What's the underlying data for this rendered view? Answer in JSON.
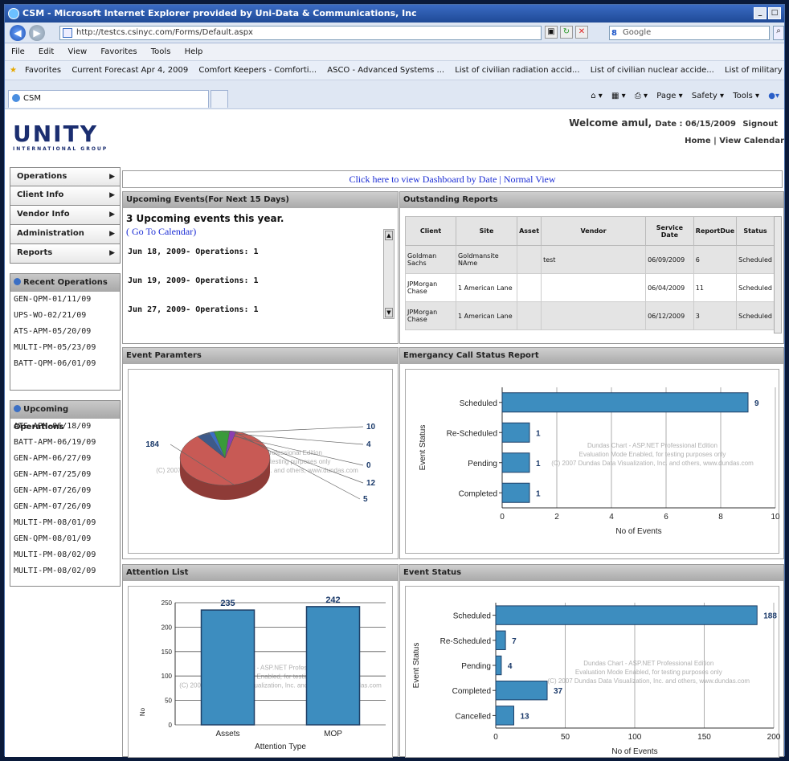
{
  "window": {
    "title": "CSM - Microsoft Internet Explorer provided by Uni-Data & Communications, Inc"
  },
  "address": {
    "url": "http://testcs.csinyc.com/Forms/Default.aspx",
    "search_placeholder": "Google"
  },
  "menu": [
    "File",
    "Edit",
    "View",
    "Favorites",
    "Tools",
    "Help"
  ],
  "favorites": {
    "label": "Favorites",
    "items": [
      "Current Forecast Apr 4, 2009",
      "Comfort Keepers - Comforti...",
      "ASCO - Advanced Systems ...",
      "List of civilian radiation accid...",
      "List of civilian nuclear accide...",
      "List of military nuclear accid..."
    ]
  },
  "tab": {
    "label": "CSM"
  },
  "commandbar": [
    "Page ▾",
    "Safety ▾",
    "Tools ▾"
  ],
  "header": {
    "logo_main": "UNITY",
    "logo_sub": "INTERNATIONAL GROUP",
    "welcome": "Welcome amul,",
    "date": "Date : 06/15/2009",
    "signout": "Signout",
    "home": "Home",
    "view_calendar": "View Calendar"
  },
  "sidebar": {
    "nav": [
      "Operations",
      "Client Info",
      "Vendor Info",
      "Administration",
      "Reports"
    ],
    "recent_title": "Recent Operations",
    "recent": [
      "GEN-QPM-01/11/09",
      "UPS-WO-02/21/09",
      "ATS-APM-05/20/09",
      "MULTI-PM-05/23/09",
      "BATT-QPM-06/01/09"
    ],
    "upcoming_title": "Upcoming Operations",
    "upcoming": [
      "ATS-APM-06/18/09",
      "BATT-APM-06/19/09",
      "GEN-APM-06/27/09",
      "GEN-APM-07/25/09",
      "GEN-APM-07/26/09",
      "GEN-APM-07/26/09",
      "MULTI-PM-08/01/09",
      "GEN-QPM-08/01/09",
      "MULTI-PM-08/02/09",
      "MULTI-PM-08/02/09"
    ]
  },
  "dashlink": {
    "by_date": "Click here to view Dashboard by Date",
    "sep": " | ",
    "normal": "Normal View"
  },
  "upcoming_events": {
    "title": "Upcoming Events(For Next 15 Days)",
    "summary": "3 Upcoming events this year.",
    "go_calendar": "( Go To Calendar)",
    "events": [
      "Jun 18, 2009- Operations: 1",
      "Jun 19, 2009- Operations: 1",
      "Jun 27, 2009- Operations: 1"
    ]
  },
  "outstanding": {
    "title": "Outstanding Reports",
    "columns": [
      "Client",
      "Site",
      "Asset",
      "Vendor",
      "Service Date",
      "ReportDue",
      "Status"
    ],
    "rows": [
      [
        "Goldman Sachs",
        "Goldmansite NAme",
        "",
        "test",
        "06/09/2009",
        "6",
        "Scheduled"
      ],
      [
        "JPMorgan Chase",
        "1 American Lane",
        "",
        "",
        "06/04/2009",
        "11",
        "Scheduled"
      ],
      [
        "JPMorgan Chase",
        "1 American Lane",
        "",
        "",
        "06/12/2009",
        "3",
        "Scheduled"
      ]
    ]
  },
  "watermark": {
    "l1": "Dundas Chart - ASP.NET Professional Edition",
    "l2": "Evaluation Mode Enabled, for testing purposes only",
    "l3": "(C) 2007 Dundas Data Visualization, Inc. and others, www.dundas.com"
  },
  "chart_data": [
    {
      "type": "pie",
      "title": "Event Paramters",
      "values": [
        184,
        10,
        4,
        0,
        12,
        5
      ],
      "colors": [
        "#c85a55",
        "#3d5a8a",
        "#3b6fc4",
        "#5aa0d8",
        "#3a9a3a",
        "#8b3fb0"
      ]
    },
    {
      "type": "bar",
      "orientation": "horizontal",
      "title": "Emergancy Call Status Report",
      "categories": [
        "Scheduled",
        "Re-Scheduled",
        "Pending",
        "Completed"
      ],
      "values": [
        9,
        1,
        1,
        1
      ],
      "xlabel": "No of Events",
      "ylabel": "Event Status",
      "xlim": [
        0,
        10
      ],
      "xticks": [
        0,
        2,
        4,
        6,
        8,
        10
      ],
      "color": "#3d8dbf"
    },
    {
      "type": "bar",
      "title": "Attention List",
      "categories": [
        "Assets",
        "MOP"
      ],
      "values": [
        235,
        242
      ],
      "xlabel": "Attention Type",
      "ylabel": "No",
      "ylim": [
        0,
        250
      ],
      "yticks": [
        0,
        50,
        100,
        150,
        200,
        250
      ],
      "color": "#3d8dbf"
    },
    {
      "type": "bar",
      "orientation": "horizontal",
      "title": "Event Status",
      "categories": [
        "Scheduled",
        "Re-Scheduled",
        "Pending",
        "Completed",
        "Cancelled"
      ],
      "values": [
        188,
        7,
        4,
        37,
        13
      ],
      "xlabel": "No of Events",
      "ylabel": "Event Status",
      "xlim": [
        0,
        200
      ],
      "xticks": [
        0,
        50,
        100,
        150,
        200
      ],
      "color": "#3d8dbf"
    }
  ]
}
